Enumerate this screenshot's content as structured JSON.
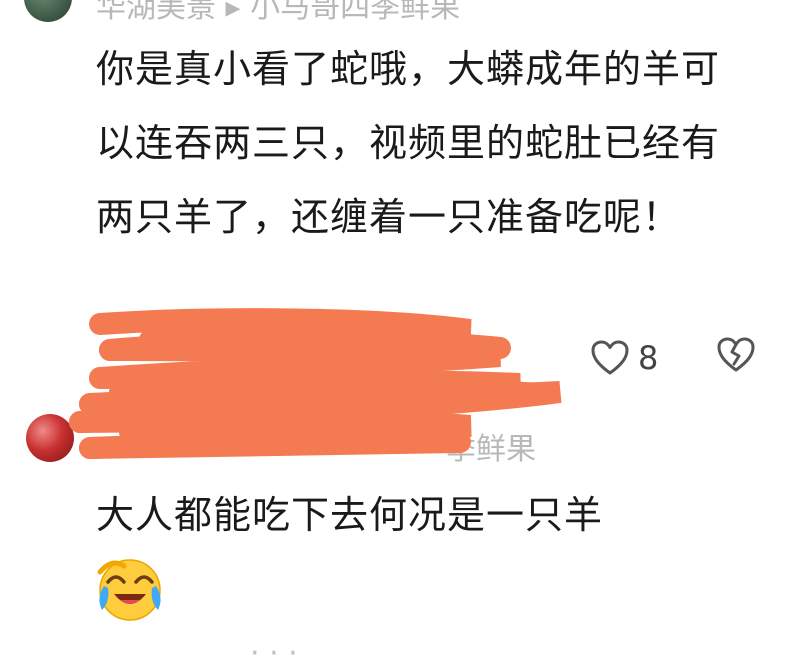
{
  "comments": [
    {
      "meta": "华湖美景 ▸ 小马哥四季鲜果",
      "text": "你是真小看了蛇哦，大蟒成年的羊可以连吞两三只，视频里的蛇肚已经有两只羊了，还缠着一只准备吃呢！",
      "likes": "8"
    },
    {
      "meta": "季鲜果",
      "text": "大人都能吃下去何况是一只羊",
      "emoji": "laughing-crying-emoji"
    }
  ],
  "icons": {
    "like": "heart-icon",
    "dislike": "broken-heart-icon"
  },
  "colors": {
    "scribble": "#f47a52",
    "text": "#1a1a1a",
    "muted": "#b8b8b8"
  }
}
